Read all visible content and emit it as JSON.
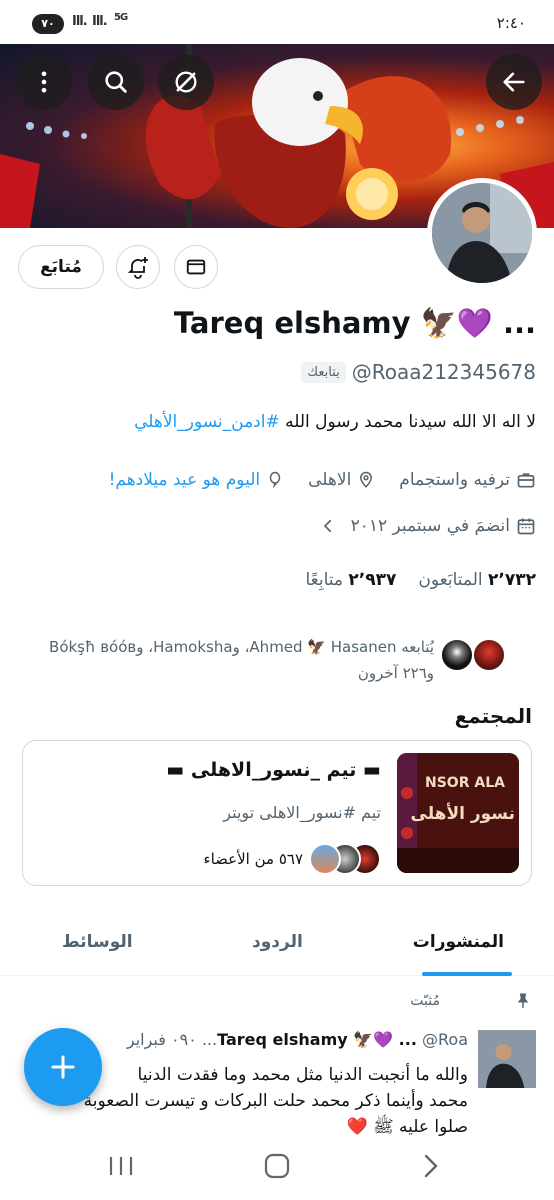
{
  "status_bar": {
    "time": "٢:٤٠",
    "battery": "٧٠",
    "network": "5G"
  },
  "header": {
    "back_icon": "arrow-left-icon",
    "menu_icon": "more-vertical-icon"
  },
  "profile": {
    "follow_button": "مُتابَع",
    "display_name": "Tareq elshamy 🦅💜 ...",
    "handle": "@Roaa212345678",
    "follows_you": "يتابعك",
    "bio_text": "لا اله الا الله سيدنا محمد رسول الله ",
    "bio_hashtag": "#ادمن_نسور_الأهلي",
    "category": "ترفيه واستجمام",
    "location": "الاهلى",
    "birthday": "اليوم هو عيد ميلادهم!",
    "joined": "انضمَ في سبتمبر ٢٠١٢",
    "following_count": "٢٬٧٣٢",
    "following_label": "المتابَعون",
    "followers_count": "٢٬٩٣٧",
    "followers_label": "متابِعًا",
    "known_followers_line1": "يُتابعه Ahmed 🦅 Hasanen، وHamoksha، وBókşħ вóóв",
    "known_followers_line2": "و٢٢٦ آخرون"
  },
  "community": {
    "section_title": "المجتمع",
    "name": "▬ تيم _نسور_الاهلى ▬",
    "description": "تيم #نسور_الاهلى تويتر",
    "members": "٥٦٧ من الأعضاء",
    "image_text_1": "NSOR ALA",
    "image_text_2": "نسور الأهلى"
  },
  "tabs": [
    {
      "label": "المنشورات",
      "active": true
    },
    {
      "label": "الردود",
      "active": false
    },
    {
      "label": "الوسائط",
      "active": false
    }
  ],
  "pinned_label": "مُثبّت",
  "tweet": {
    "author": "Tareq elshamy 🦅💜 ...",
    "handle": "@Roa...",
    "time": "٠٩٠ فبراير",
    "body_line1": "والله ما أنجبت الدنيا مثل محمد وما فقدت الدنيا",
    "body_line2": "محمد وأينما ذكر محمد حلت البركات و تيسرت الصعوبة",
    "body_line3": "صلوا عليه ﷺ ❤️"
  },
  "colors": {
    "accent": "#1d9bf0",
    "text": "#0f1419",
    "muted": "#536471"
  }
}
